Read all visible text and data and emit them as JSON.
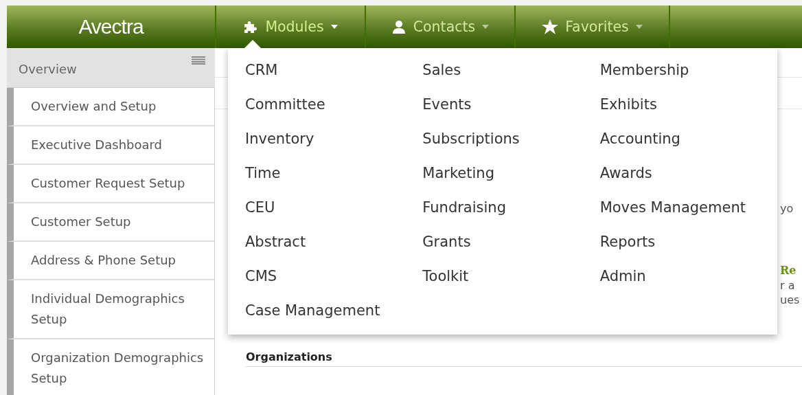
{
  "header": {
    "logo": "Avectra",
    "nav": [
      {
        "label": "Modules",
        "selected": true
      },
      {
        "label": "Contacts",
        "selected": false
      },
      {
        "label": "Favorites",
        "selected": false
      }
    ]
  },
  "sidebar": {
    "title": "Overview",
    "items": [
      "Overview and Setup",
      "Executive Dashboard",
      "Customer Request Setup",
      "Customer Setup",
      "Address & Phone Setup",
      "Individual Demographics Setup",
      "Organization Demographics Setup"
    ]
  },
  "modules_menu": {
    "columns": [
      [
        "CRM",
        "Committee",
        "Inventory",
        "Time",
        "CEU",
        "Abstract",
        "CMS",
        "Case Management"
      ],
      [
        "Sales",
        "Events",
        "Subscriptions",
        "Marketing",
        "Fundraising",
        "Grants",
        "Toolkit"
      ],
      [
        "Membership",
        "Exhibits",
        "Accounting",
        "Awards",
        "Moves Management",
        "Reports",
        "Admin"
      ]
    ]
  },
  "main": {
    "fragments": [
      {
        "text": "yo",
        "kind": "plain"
      },
      {
        "text": "Re",
        "kind": "heading"
      },
      {
        "text": "r a",
        "kind": "plain"
      },
      {
        "text": "ues",
        "kind": "plain"
      }
    ],
    "section_heading": "Organizations"
  }
}
